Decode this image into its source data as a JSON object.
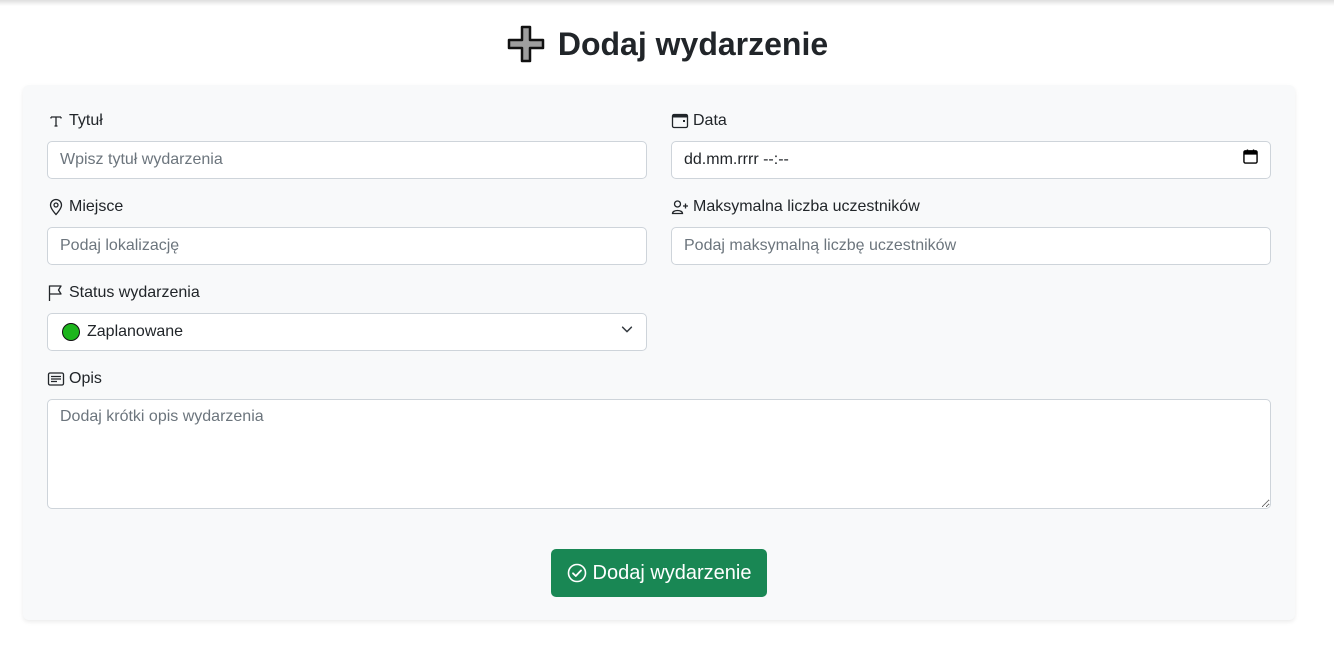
{
  "page": {
    "title": "Dodaj wydarzenie"
  },
  "form": {
    "title_field": {
      "label": "Tytuł",
      "icon": "text-icon",
      "placeholder": "Wpisz tytuł wydarzenia"
    },
    "date_field": {
      "label": "Data",
      "icon": "calendar-icon",
      "value": "dd.mm.rrrr --:--"
    },
    "place_field": {
      "label": "Miejsce",
      "icon": "location-pin-icon",
      "placeholder": "Podaj lokalizację"
    },
    "max_participants_field": {
      "label": "Maksymalna liczba uczestników",
      "icon": "person-plus-icon",
      "placeholder": "Podaj maksymalną liczbę uczestników"
    },
    "status_field": {
      "label": "Status wydarzenia",
      "icon": "flag-icon",
      "selected": "Zaplanowane",
      "selected_color": "#1db51d"
    },
    "description_field": {
      "label": "Opis",
      "icon": "card-text-icon",
      "placeholder": "Dodaj krótki opis wydarzenia"
    },
    "submit": {
      "label": "Dodaj wydarzenie",
      "icon": "check-circle-icon",
      "color": "#198754"
    }
  }
}
